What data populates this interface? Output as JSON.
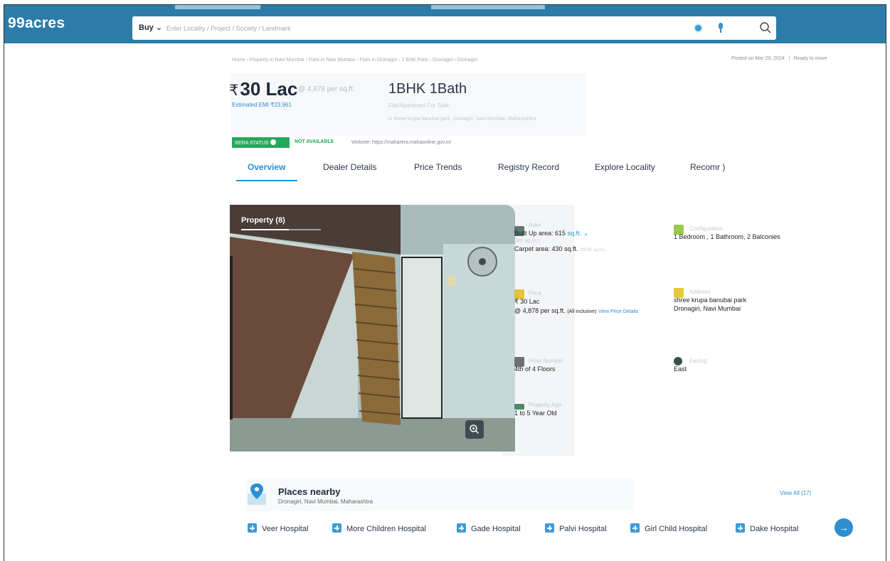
{
  "header": {
    "logo": "99acres",
    "search_type": "Buy ⌄",
    "search_placeholder": "Enter Locality / Project / Society / Landmark"
  },
  "breadcrumb": "Home › Property in Navi Mumbai › Flats in Navi Mumbai › Flats in Dronagiri › 1 BHK Flats › Dronagiri › Dronagiri",
  "posted": {
    "date": "Posted on Mar 29, 2024",
    "status": "Ready to move"
  },
  "listing": {
    "price": "30 Lac",
    "rupee": "₹",
    "per_sqft": "@ 4,878 per sq.ft.",
    "emi": "Estimated EMI ₹23,961",
    "title": "1BHK 1Bath",
    "subtitle": "Flat/Apartment For Sale",
    "address_line": "in shree krupa banubai park, Dronagiri, Navi Mumbai, Maharashtra",
    "rera_label": "RERA STATUS",
    "rera_value": "NOT AVAILABLE",
    "website": "Website: https://maharera.mahaonline.gov.in/"
  },
  "tabs": [
    "Overview",
    "Dealer Details",
    "Price Trends",
    "Registry Record",
    "Explore Locality",
    "Recomr )"
  ],
  "photo": {
    "label": "Property (8)",
    "progress": 0.6
  },
  "details": {
    "area": {
      "label": "Area",
      "built_up": "Built Up area: 615",
      "unit": "sq.ft. ⌄",
      "carpet_label": "(40 sq.m.)",
      "carpet": "Carpet area: 430 sq.ft.",
      "carpet_sqm": "(39.95 sq.m.)"
    },
    "configuration": {
      "label": "Configuration",
      "value": "1 Bedroom , 1 Bathroom, 2 Balconies"
    },
    "price": {
      "label": "Price",
      "value": "₹ 30 Lac",
      "per_sqft": "@ 4,878 per sq.ft.",
      "note": "(All inclusive)",
      "link": "View Price Details"
    },
    "address": {
      "label": "Address",
      "line1": "shree krupa banubai park",
      "line2": "Dronagiri, Navi Mumbai"
    },
    "floor": {
      "label": "Floor Number",
      "value": "4th of 4 Floors"
    },
    "facing": {
      "label": "Facing",
      "value": "East"
    },
    "age": {
      "label": "Property Age",
      "value": "1 to 5 Year Old"
    }
  },
  "places": {
    "title": "Places nearby",
    "subtitle": "Dronagiri, Navi Mumbai, Maharashtra",
    "view_all": "View All (17)",
    "items": [
      "Veer Hospital",
      "More Children Hospital",
      "Gade Hospital",
      "Palvi Hospital",
      "Girl Child Hospital",
      "Dake Hospital"
    ]
  },
  "colors": {
    "brand": "#2d7ba8",
    "accent": "#2b8fd0",
    "rera_green": "#26a85a"
  }
}
